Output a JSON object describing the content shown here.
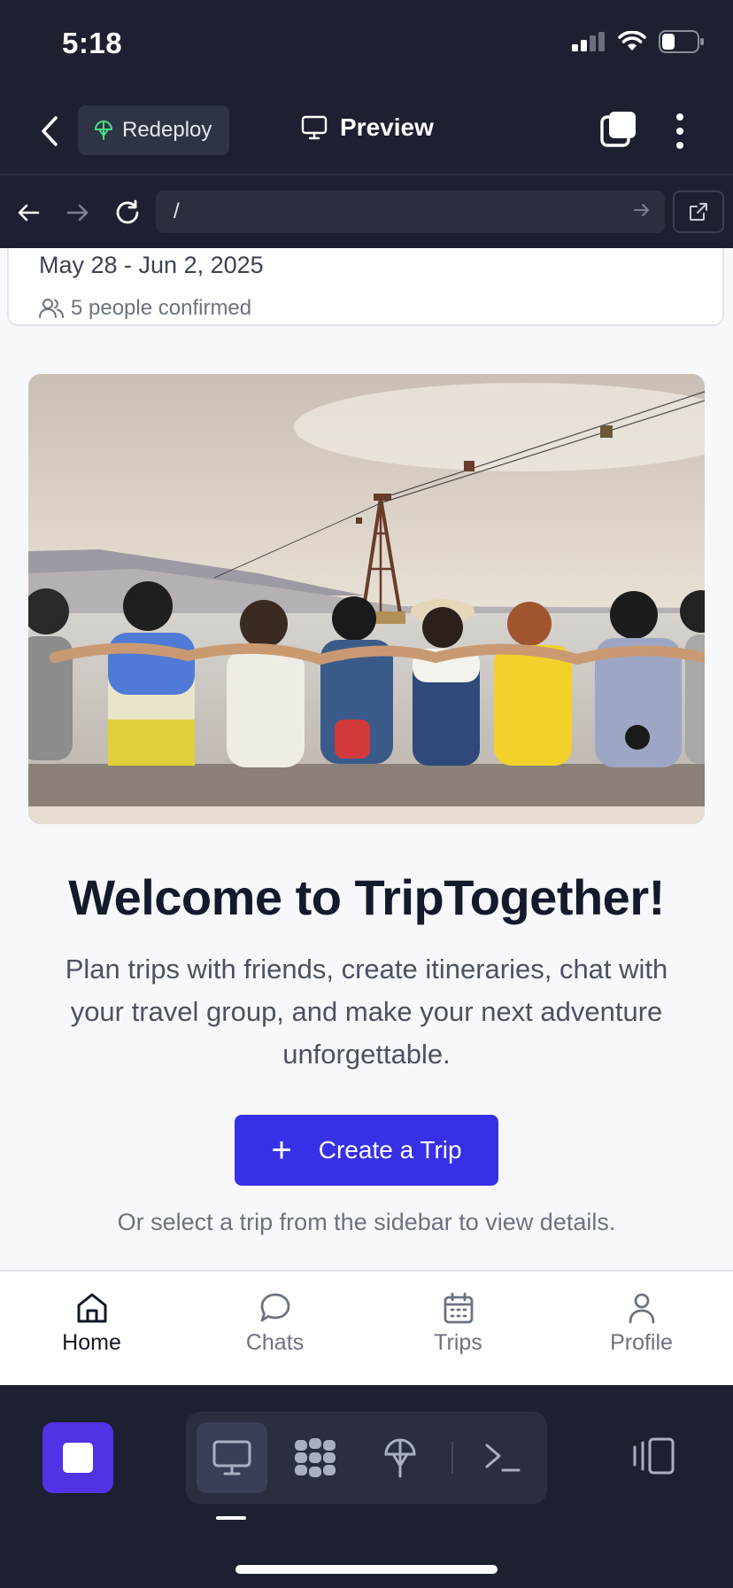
{
  "status_bar": {
    "time": "5:18"
  },
  "header": {
    "redeploy_label": "Redeploy",
    "title": "Preview"
  },
  "url_bar": {
    "url": "/"
  },
  "trip_card": {
    "dates": "May 28 - Jun 2, 2025",
    "people": "5 people confirmed"
  },
  "hero_image": {
    "description_icon": "group-photo"
  },
  "welcome": {
    "title": "Welcome to TripTogether!",
    "subtitle": "Plan trips with friends, create itineraries, chat with your travel group, and make your next adventure unforgettable.",
    "create_button_icon": "+",
    "create_button_label": "Create a Trip",
    "hint": "Or select a trip from the sidebar to view details."
  },
  "bottom_nav": {
    "items": [
      {
        "label": "Home",
        "icon": "home-icon",
        "active": true
      },
      {
        "label": "Chats",
        "icon": "chat-icon",
        "active": false
      },
      {
        "label": "Trips",
        "icon": "calendar-icon",
        "active": false
      },
      {
        "label": "Profile",
        "icon": "user-icon",
        "active": false
      }
    ]
  },
  "colors": {
    "accent": "#3730e6",
    "stop_button": "#5332e6",
    "chrome_bg": "#1d2030"
  }
}
